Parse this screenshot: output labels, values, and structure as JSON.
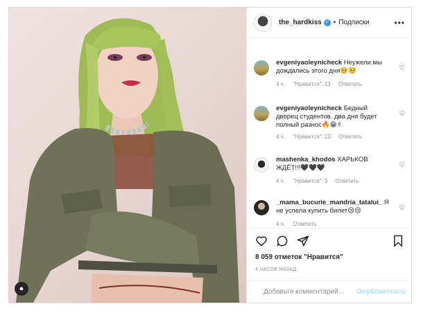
{
  "header": {
    "username": "the_hardkiss",
    "separator": "•",
    "follow_label": "Подписки",
    "more_label": "•••"
  },
  "comments": [
    {
      "username": "evgeniyaoleynicheck",
      "text": "Неужели мы дождались этого дня🥺🥺",
      "time": "4 ч.",
      "likes": "\"Нравится\": 13",
      "reply": "Ответить",
      "avatar": "desert"
    },
    {
      "username": "evgeniyaoleynicheck",
      "text": "Бедный дворец студентов. два дня будет полный разнос🔥😁✌",
      "time": "4 ч.",
      "likes": "\"Нравится\": 13",
      "reply": "Ответить",
      "avatar": "desert"
    },
    {
      "username": "mashenka_khodos",
      "text": "ХАРЬКОВ ЖДЁТ!!!🖤🖤🖤",
      "time": "4 ч.",
      "likes": "\"Нравится\": 3",
      "reply": "Ответить",
      "avatar": "white"
    },
    {
      "username": "_mama_bucurie_mandria_tatalui_",
      "text": "Я не успела купить билет😢😢",
      "time": "4 ч.",
      "likes": "",
      "reply": "Ответить",
      "avatar": "dark"
    }
  ],
  "likes": {
    "count": "8 059 отметок",
    "label": "\"Нравится\""
  },
  "time_ago": "4 ЧАСОВ НАЗАД",
  "add_comment": {
    "placeholder": "Добавьте комментарий...",
    "publish": "Опубликовать"
  },
  "colors": {
    "verified": "#3897f0",
    "publish_disabled": "#b2dffc",
    "hair": "#a6c25a",
    "jacket": "#6f7258"
  },
  "icons": {
    "like": "heart-icon",
    "comment": "comment-icon",
    "share": "paper-plane-icon",
    "save": "bookmark-icon",
    "emoji": "smiley-icon",
    "user_tag": "person-icon"
  }
}
